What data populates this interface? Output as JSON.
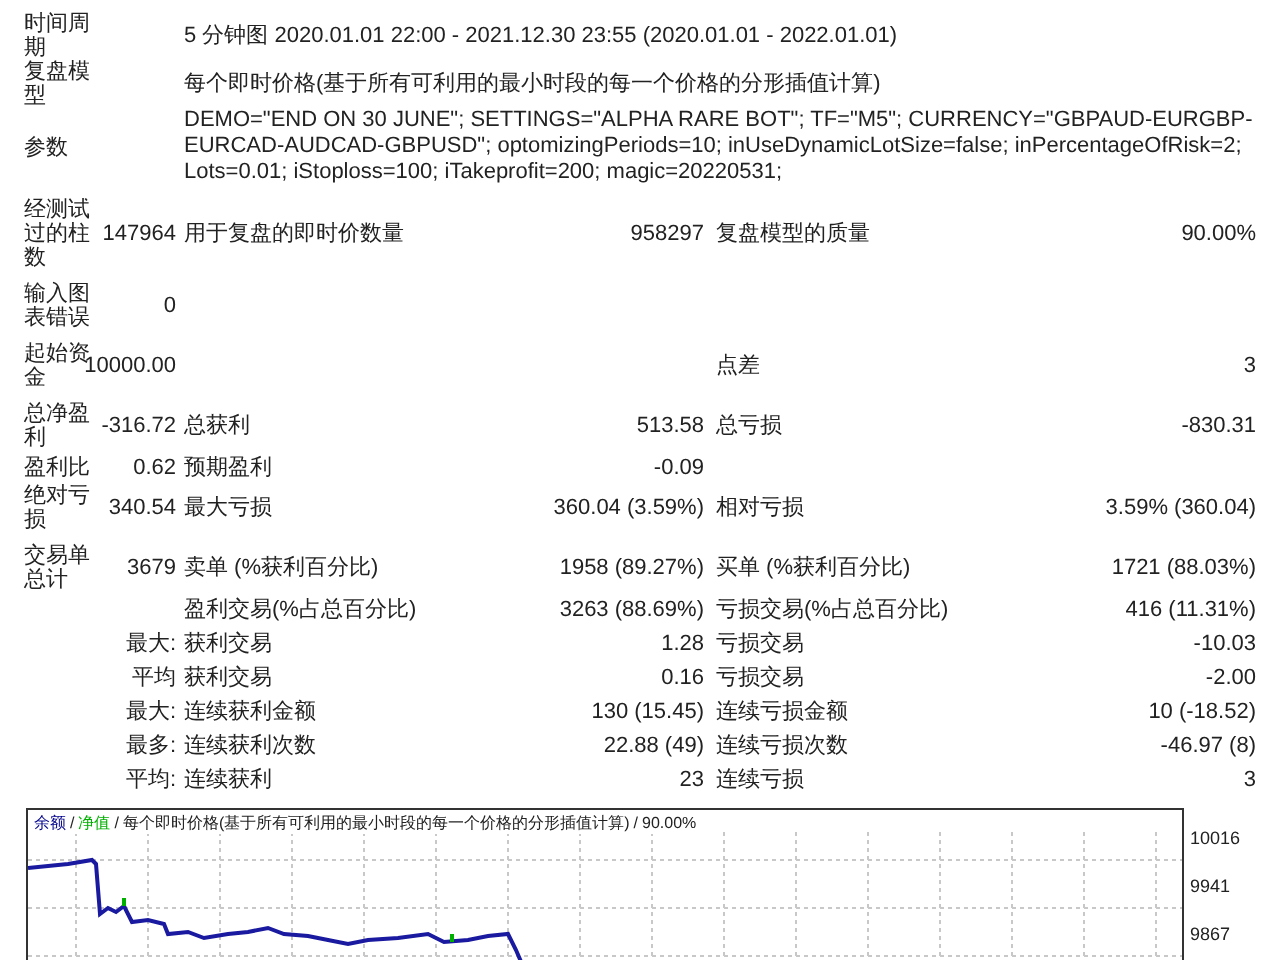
{
  "report": {
    "groups": [
      {
        "rows": [
          {
            "kind": "span",
            "label": "时间周期",
            "text": "5 分钟图 2020.01.01 22:00 - 2021.12.30 23:55 (2020.01.01 - 2022.01.01)"
          },
          {
            "kind": "span",
            "label": "复盘模型",
            "text": "每个即时价格(基于所有可利用的最小时段的每一个价格的分形插值计算)"
          },
          {
            "kind": "span",
            "label": "参数",
            "text": "DEMO=\"END ON 30 JUNE\"; SETTINGS=\"ALPHA RARE BOT\"; TF=\"M5\"; CURRENCY=\"GBPAUD-EURGBP-EURCAD-AUDCAD-GBPUSD\"; optomizingPeriods=10; inUseDynamicLotSize=false; inPercentageOfRisk=2; Lots=0.01; iStoploss=100; iTakeprofit=200; magic=20220531;"
          }
        ]
      },
      {
        "rows": [
          {
            "kind": "stats",
            "label": "经测试过的柱数",
            "value": "147964",
            "label_2": "用于复盘的即时价数量",
            "value_2": "958297",
            "label_3": "复盘模型的质量",
            "value_3": "90.00%"
          }
        ]
      },
      {
        "rows": [
          {
            "kind": "stats",
            "label": "输入图表错误",
            "value": "0"
          }
        ]
      },
      {
        "rows": [
          {
            "kind": "stats",
            "label": "起始资金",
            "value": "10000.00",
            "label_3": "点差",
            "value_3": "3"
          }
        ]
      },
      {
        "rows": [
          {
            "kind": "stats",
            "label": "总净盈利",
            "value": "-316.72",
            "label_2": "总获利",
            "value_2": "513.58",
            "label_3": "总亏损",
            "value_3": "-830.31"
          },
          {
            "kind": "stats",
            "label": "盈利比",
            "value": "0.62",
            "label_2": "预期盈利",
            "value_2": "-0.09"
          },
          {
            "kind": "stats",
            "label": "绝对亏损",
            "value": "340.54",
            "label_2": "最大亏损",
            "value_2": "360.04 (3.59%)",
            "label_3": "相对亏损",
            "value_3": "3.59% (360.04)"
          }
        ]
      },
      {
        "rows": [
          {
            "kind": "stats",
            "label": "交易单总计",
            "value": "3679",
            "label_2": "卖单 (%获利百分比)",
            "value_2": "1958 (89.27%)",
            "label_3": "买单 (%获利百分比)",
            "value_3": "1721 (88.03%)"
          },
          {
            "kind": "stats",
            "label_2": "盈利交易(%占总百分比)",
            "value_2": "3263 (88.69%)",
            "label_3": "亏损交易(%占总百分比)",
            "value_3": "416 (11.31%)"
          },
          {
            "kind": "stats",
            "value": "最大:",
            "label_2": "获利交易",
            "value_2": "1.28",
            "label_3": "亏损交易",
            "value_3": "-10.03"
          },
          {
            "kind": "stats",
            "value": "平均",
            "label_2": "获利交易",
            "value_2": "0.16",
            "label_3": "亏损交易",
            "value_3": "-2.00"
          },
          {
            "kind": "stats",
            "value": "最大:",
            "label_2": "连续获利金额",
            "value_2": "130 (15.45)",
            "label_3": "连续亏损金额",
            "value_3": "10 (-18.52)"
          },
          {
            "kind": "stats",
            "value": "最多:",
            "label_2": "连续获利次数",
            "value_2": "22.88 (49)",
            "label_3": "连续亏损次数",
            "value_3": "-46.97 (8)"
          },
          {
            "kind": "stats",
            "value": "平均:",
            "label_2": "连续获利",
            "value_2": "23",
            "label_3": "连续亏损",
            "value_3": "3"
          }
        ]
      }
    ]
  },
  "chart": {
    "legend": [
      {
        "kind": "series",
        "text": "余额",
        "color": "#00008b"
      },
      {
        "kind": "separator",
        "text": "/"
      },
      {
        "kind": "series",
        "text": "净值",
        "color": "#00b000"
      },
      {
        "kind": "separator",
        "text": "/"
      },
      {
        "kind": "note",
        "text": "每个即时价格(基于所有可利用的最小时段的每一个价格的分形插值计算)"
      },
      {
        "kind": "separator",
        "text": "/"
      },
      {
        "kind": "note",
        "text": "90.00%"
      }
    ],
    "y_labels": [
      "10016",
      "9941",
      "9867"
    ]
  }
}
